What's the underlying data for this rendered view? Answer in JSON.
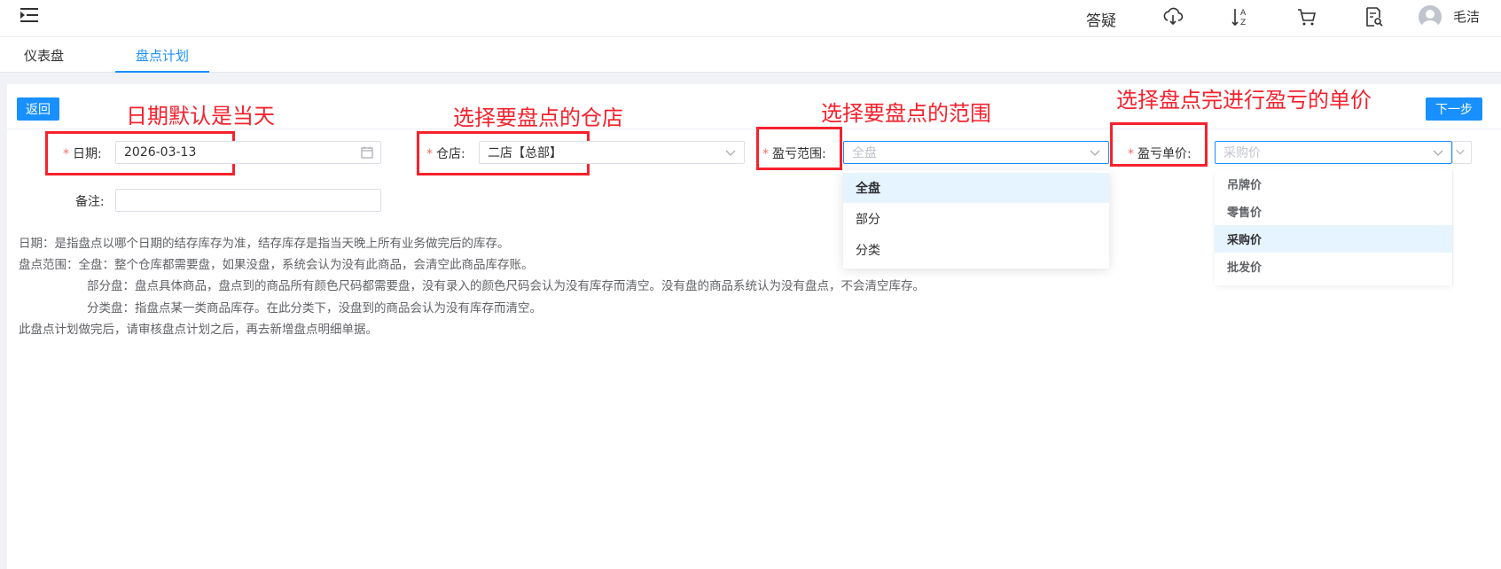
{
  "header": {
    "qa_label": "答疑",
    "user_name": "毛洁",
    "icons": [
      "menu-fold-icon",
      "cloud-download-icon",
      "sort-az-icon",
      "cart-icon",
      "document-search-icon",
      "user-avatar-icon"
    ]
  },
  "tabs": [
    {
      "label": "仪表盘"
    },
    {
      "label": "盘点计划"
    }
  ],
  "toolbar": {
    "back_label": "返回",
    "next_label": "下一步"
  },
  "annotations": {
    "date": "日期默认是当天",
    "store": "选择要盘点的仓店",
    "scope": "选择要盘点的范围",
    "price": "选择盘点完进行盈亏的单价"
  },
  "form": {
    "date_label": "日期:",
    "date_value": "2026-03-13",
    "store_label": "仓店:",
    "store_value": "二店【总部】",
    "scope_label": "盈亏范围:",
    "scope_placeholder": "全盘",
    "price_label": "盈亏单价:",
    "price_placeholder": "采购价",
    "note_label": "备注:",
    "note_value": ""
  },
  "scope_options": [
    "全盘",
    "部分",
    "分类"
  ],
  "price_options": [
    "吊牌价",
    "零售价",
    "采购价",
    "批发价"
  ],
  "descriptions": [
    "日期：是指盘点以哪个日期的结存库存为准，结存库存是指当天晚上所有业务做完后的库存。",
    "盘点范围：全盘：整个仓库都需要盘，如果没盘，系统会认为没有此商品，会清空此商品库存账。",
    "部分盘：盘点具体商品，盘点到的商品所有颜色尺码都需要盘，没有录入的颜色尺码会认为没有库存而清空。没有盘的商品系统认为没有盘点，不会清空库存。",
    "分类盘：指盘点某一类商品库存。在此分类下，没盘到的商品会认为没有库存而清空。",
    "此盘点计划做完后，请审核盘点计划之后，再去新增盘点明细单据。"
  ],
  "colors": {
    "accent": "#1890ff",
    "annotation": "#f5222d",
    "required": "#f56c6c"
  }
}
